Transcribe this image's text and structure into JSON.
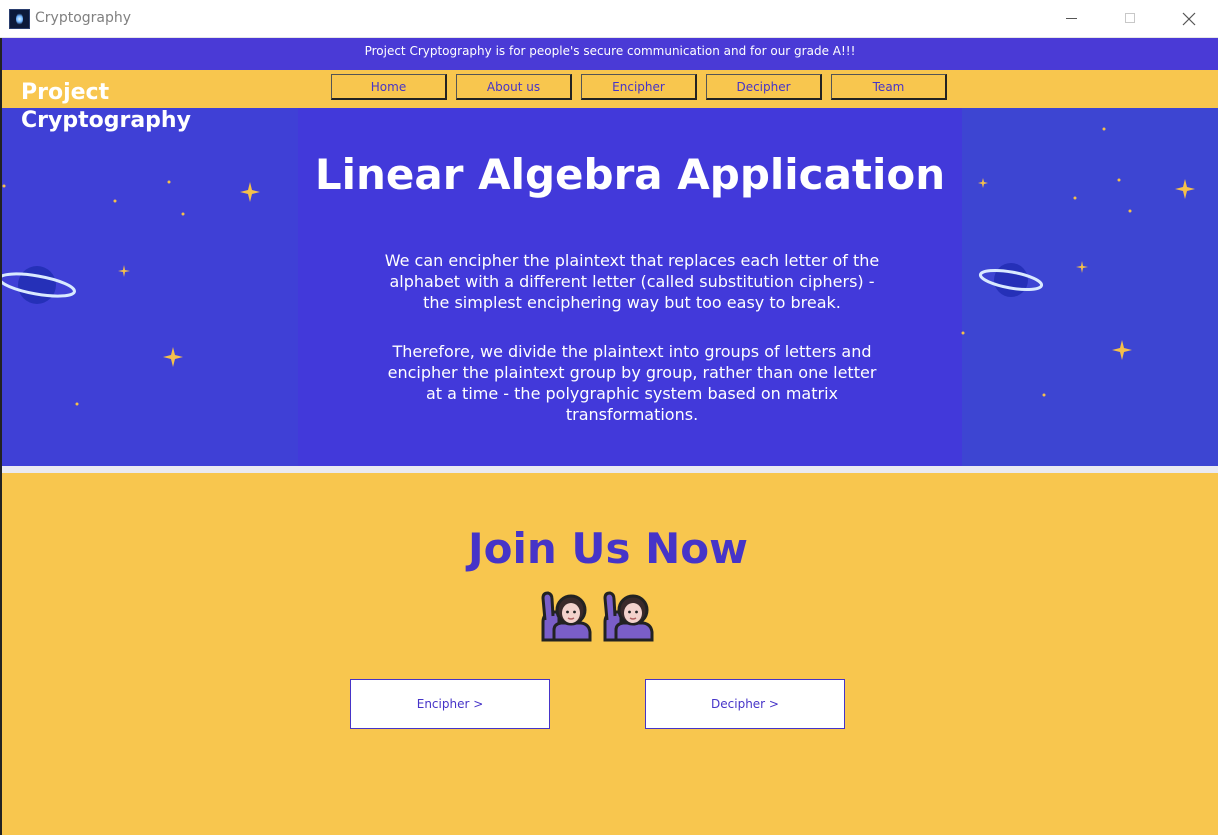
{
  "window": {
    "title": "Cryptography"
  },
  "announcement": "Project Cryptography is for people's secure communication and for our grade A!!!",
  "brand": {
    "line1": "Project",
    "line2": "Cryptography"
  },
  "nav": [
    {
      "label": "Home"
    },
    {
      "label": "About us"
    },
    {
      "label": "Encipher"
    },
    {
      "label": "Decipher"
    },
    {
      "label": "Team"
    }
  ],
  "hero": {
    "title": "Linear Algebra Application",
    "paragraph1": "We can encipher the plaintext that replaces each letter of the alphabet with a different letter (called substitution ciphers) - the simplest enciphering way but too easy to break.",
    "paragraph2": "Therefore, we divide the plaintext into groups of letters and encipher the plaintext group by group, rather than one letter at a time - the polygraphic system based on matrix transformations."
  },
  "join": {
    "title": "Join Us Now",
    "emoji_icons": [
      "person-raising-hand-icon",
      "person-raising-hand-icon"
    ],
    "encipher_label": "Encipher >",
    "decipher_label": "Decipher >"
  },
  "colors": {
    "primary_blue": "#4634c8",
    "hero_blue": "#3d3fd8",
    "accent_yellow": "#f8c64e",
    "white": "#ffffff"
  },
  "decor_icons": [
    "planet-icon",
    "star-icon"
  ]
}
